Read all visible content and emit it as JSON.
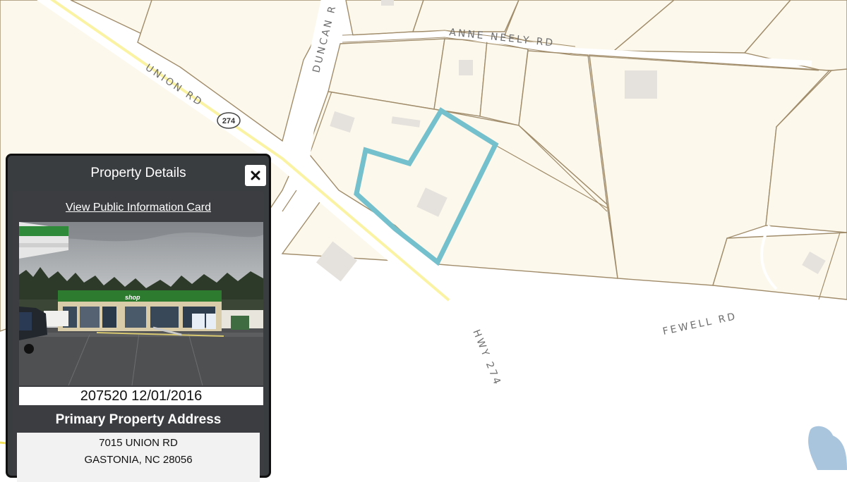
{
  "map": {
    "roads": {
      "union_rd": "UNION RD",
      "route_shield": "274",
      "duncan": "DUNCAN R",
      "anne_neely": "ANNE NEELY RD",
      "fewell": "FEWELL RD",
      "hwy_274": "HWY 274"
    },
    "colors": {
      "parcel_fill": "#fcf8ec",
      "parcel_line": "#a08c6a",
      "road_fill": "#ffffff",
      "highway_line": "#fbf3a4",
      "selection": "#74c0cc",
      "water": "#a9c4dd",
      "building": "#e5e1dc"
    }
  },
  "panel": {
    "title": "Property Details",
    "close_icon": "close-icon",
    "info_card_link": "View Public Information Card",
    "photo_caption": "207520  12/01/2016",
    "photo_sign": "shop",
    "address_heading": "Primary Property Address",
    "address_line1": "7015 UNION RD",
    "address_line2": "GASTONIA, NC 28056"
  }
}
